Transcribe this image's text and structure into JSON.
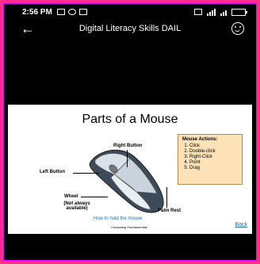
{
  "status_bar": {
    "time": "2:56 PM",
    "battery": "85"
  },
  "header": {
    "title": "Digital Literacy Skills DAIL"
  },
  "slide": {
    "title": "Parts of a Mouse",
    "labels": {
      "right_button": "Right Button",
      "left_button": "Left Button",
      "wheel": "Wheel",
      "wheel_note": "(Not always available)",
      "palm_rest": "Palm Rest"
    },
    "actions_header": "Mouse Actions:",
    "actions": [
      "Click",
      "Double-click",
      "Right-Click",
      "Point",
      "Drag"
    ],
    "howto_link": "How to hold the mouse",
    "footer": "Computing Fundamentals",
    "back_link": "Back"
  },
  "colors": {
    "frame": "#ff2d8a",
    "link": "#1a6fb5",
    "actions_bg": "#fde2b8"
  }
}
